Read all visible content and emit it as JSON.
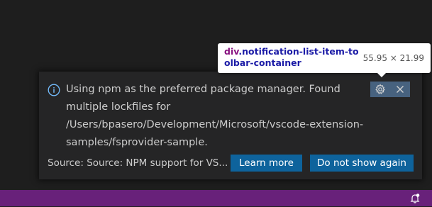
{
  "notification": {
    "message": "Using npm as the preferred package manager. Found multiple lockfiles for /Users/bpasero/Development/Microsoft/vscode-extension-samples/fsprovider-sample.",
    "source": "Source: Source: NPM support for VS...",
    "buttons": {
      "learn_more": "Learn more",
      "do_not_show": "Do not show again"
    },
    "icons": {
      "info": "info-icon",
      "settings": "gear-icon",
      "close": "close-icon"
    }
  },
  "tooltip": {
    "tag": "div",
    "selector_class": ".notification-list-item-toolbar-container",
    "dimensions": "55.95 × 21.99"
  },
  "status_bar": {
    "color": "#68217a",
    "icons": {
      "notifications": "bell-icon"
    }
  },
  "colors": {
    "button_bg": "#0e639c",
    "notification_bg": "#252526",
    "info_icon": "#75beff"
  }
}
